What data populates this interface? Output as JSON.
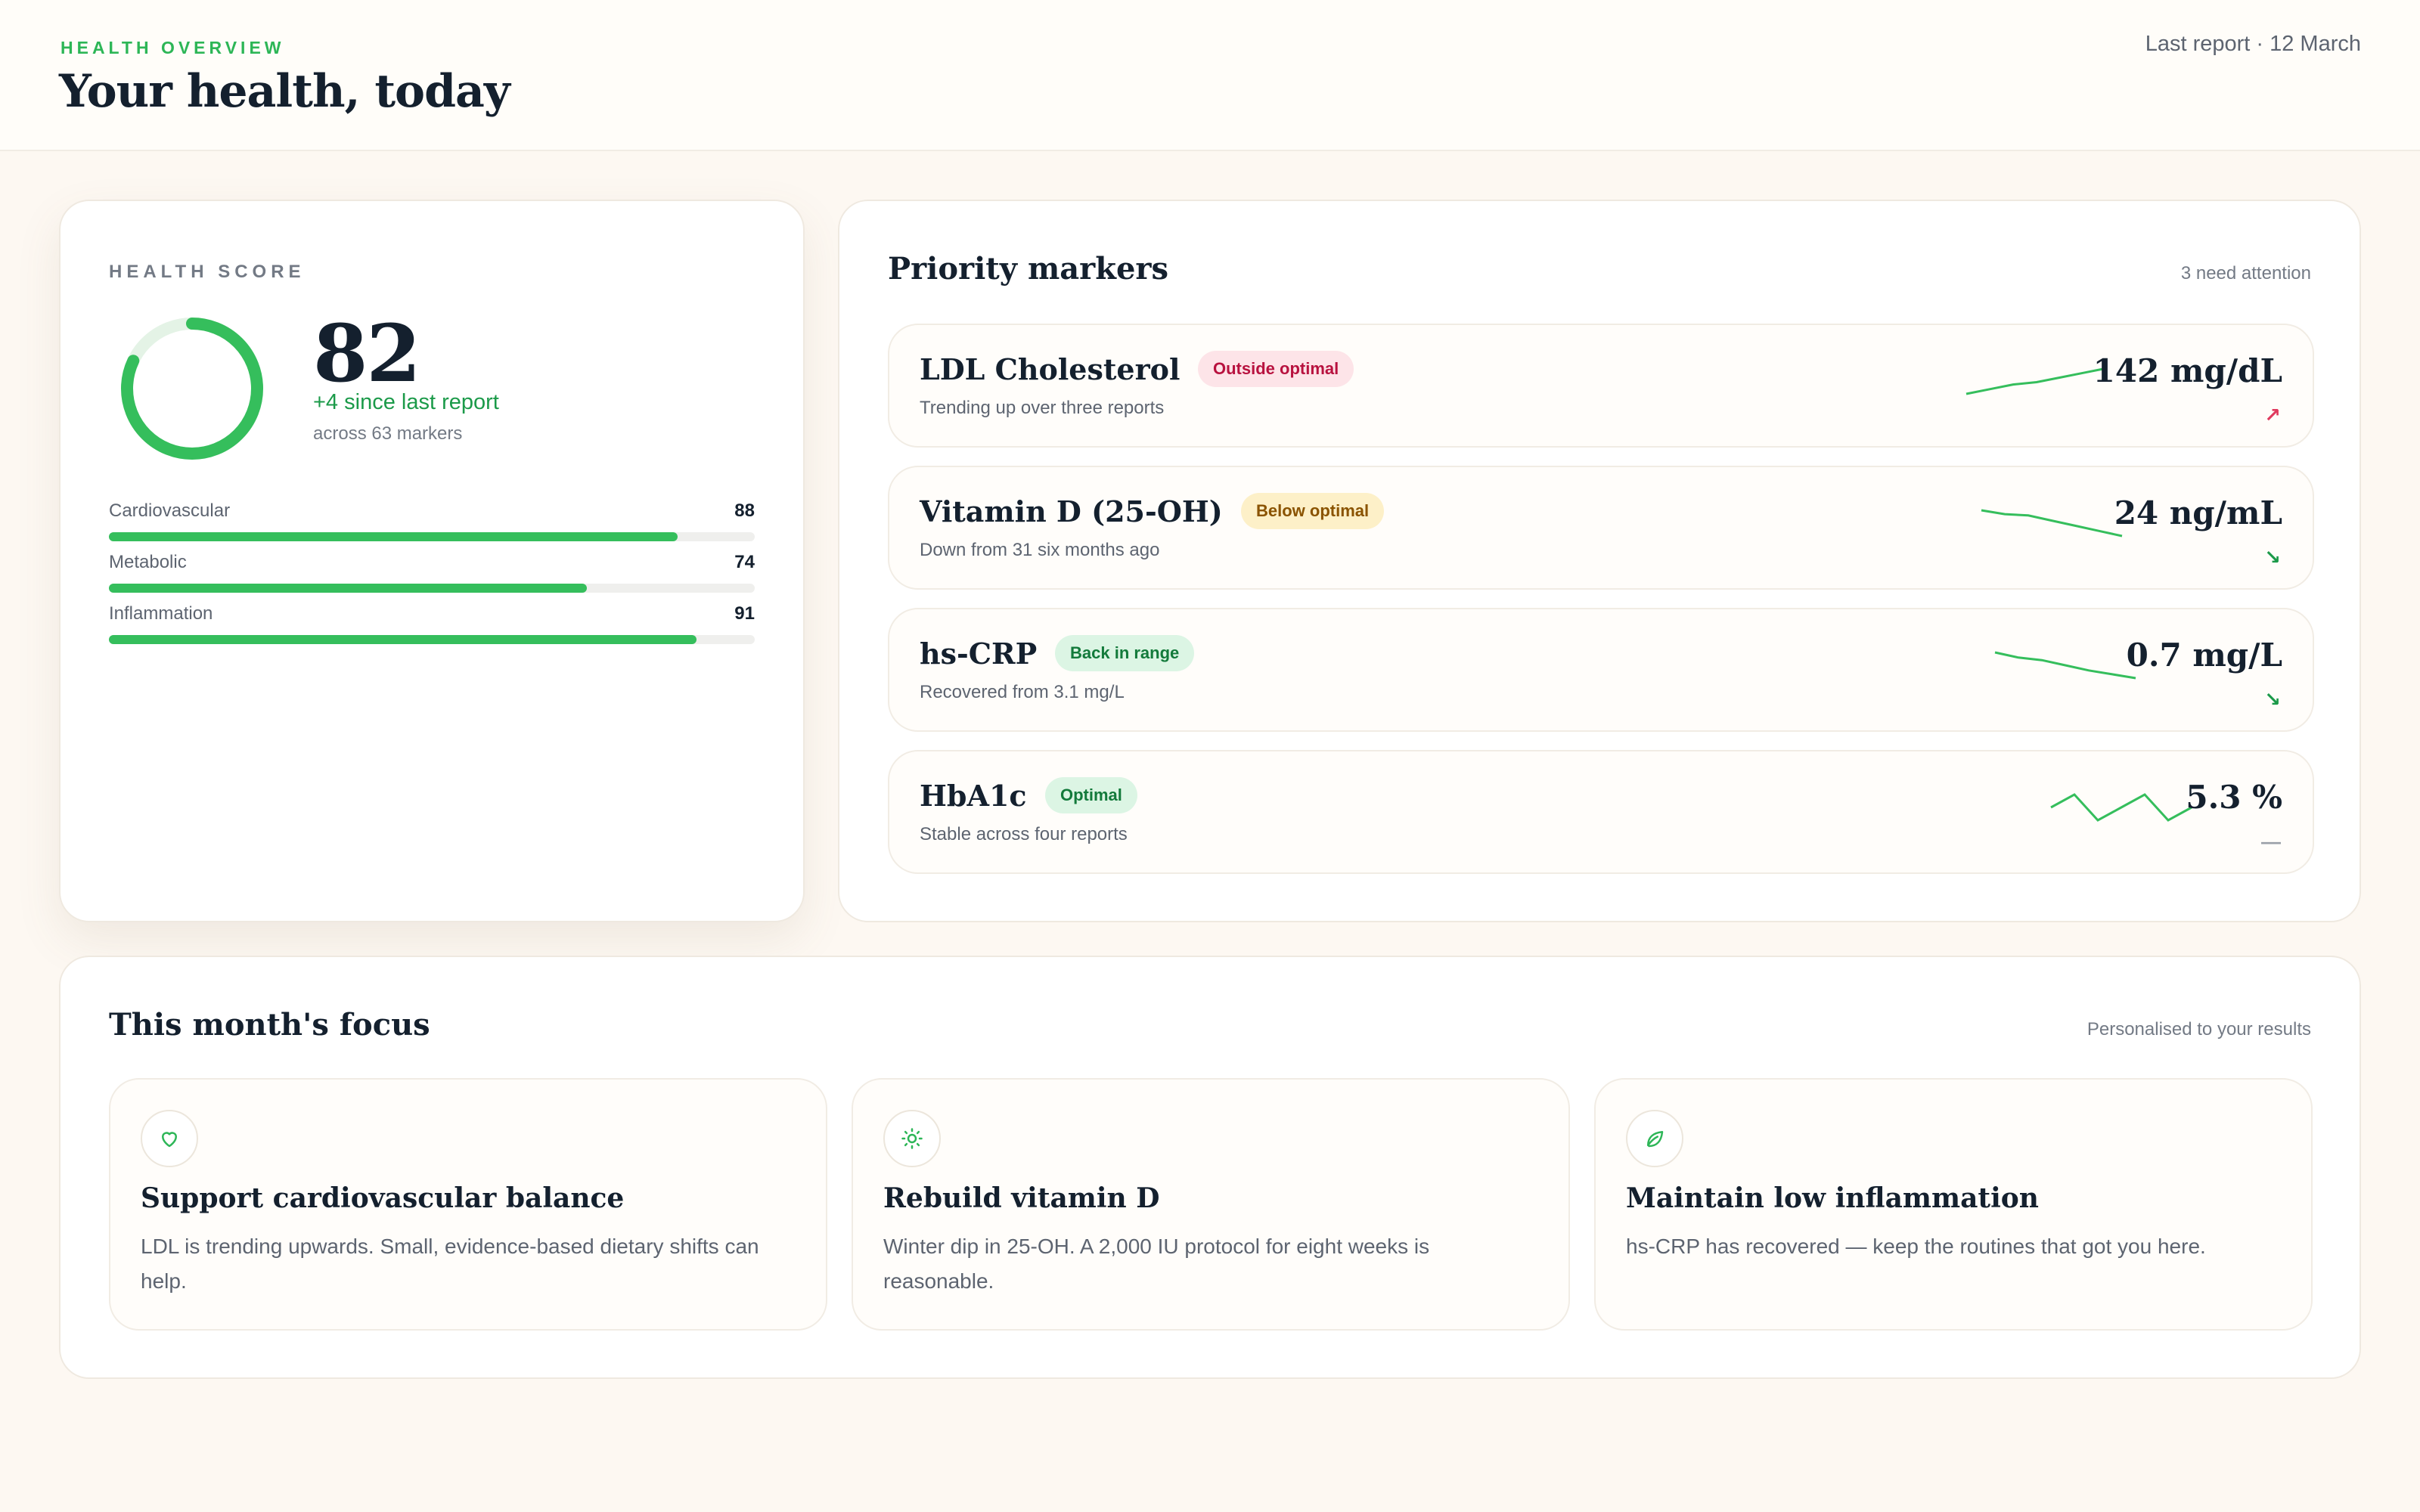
{
  "header": {
    "eyebrow": "HEALTH OVERVIEW",
    "title": "Your health, today",
    "last_report": "Last report · 12 March"
  },
  "score_card": {
    "eyebrow": "HEALTH SCORE",
    "score": "82",
    "score_fraction": 0.82,
    "delta": "+4 since last report",
    "sub": "across 63 markers",
    "ring_color": "#35be5c",
    "bars": [
      {
        "label": "Cardiovascular",
        "value": "88",
        "fraction": 0.88
      },
      {
        "label": "Metabolic",
        "value": "74",
        "fraction": 0.74
      },
      {
        "label": "Inflammation",
        "value": "91",
        "fraction": 0.91
      }
    ]
  },
  "priority": {
    "title": "Priority markers",
    "note": "3 need attention",
    "markers": [
      {
        "name": "LDL Cholesterol",
        "status": "Outside optimal",
        "status_bg": "#fde4e8",
        "status_fg": "#b8123f",
        "sub": "Trending up over three reports",
        "value": "142 mg/dL",
        "trend": "↗",
        "trend_color": "#e03a5e",
        "spark": [
          2,
          6,
          10,
          12,
          16,
          20,
          24
        ]
      },
      {
        "name": "Vitamin D (25-OH)",
        "status": "Below optimal",
        "status_bg": "#fdf0c8",
        "status_fg": "#8a5300",
        "sub": "Down from 31 six months ago",
        "value": "24 ng/mL",
        "trend": "↘",
        "trend_color": "#1b9a49",
        "spark": [
          24,
          21,
          20,
          16,
          12,
          8,
          4
        ]
      },
      {
        "name": "hs-CRP",
        "status": "Back in range",
        "status_bg": "#dcf5e4",
        "status_fg": "#137a3b",
        "sub": "Recovered from 3.1 mg/L",
        "value": "0.7 mg/L",
        "trend": "↘",
        "trend_color": "#1b9a49",
        "spark": [
          24,
          20,
          18,
          14,
          10,
          7,
          4
        ]
      },
      {
        "name": "HbA1c",
        "status": "Optimal",
        "status_bg": "#dcf5e4",
        "status_fg": "#137a3b",
        "sub": "Stable across four reports",
        "value": "5.3 %",
        "trend": "—",
        "trend_color": "#9aa0a8",
        "spark": [
          14,
          15,
          13,
          14,
          15,
          13,
          14
        ]
      }
    ]
  },
  "focus": {
    "title": "This month's focus",
    "note": "Personalised to your results",
    "items": [
      {
        "icon": "heart-icon",
        "title": "Support cardiovascular balance",
        "body": "LDL is trending upwards. Small, evidence-based dietary shifts can help."
      },
      {
        "icon": "sun-icon",
        "title": "Rebuild vitamin D",
        "body": "Winter dip in 25-OH. A 2,000 IU protocol for eight weeks is reasonable."
      },
      {
        "icon": "leaf-icon",
        "title": "Maintain low inflammation",
        "body": "hs-CRP has recovered — keep the routines that got you here."
      }
    ]
  }
}
